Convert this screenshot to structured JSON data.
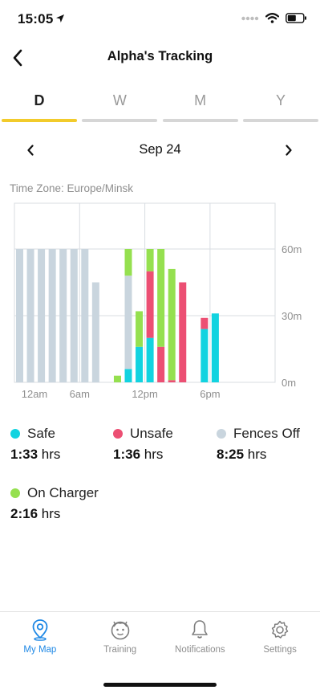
{
  "status_bar": {
    "time": "15:05"
  },
  "header": {
    "title": "Alpha's Tracking",
    "back_icon": "chevron-left-icon"
  },
  "tabs": [
    {
      "label": "D",
      "active": true
    },
    {
      "label": "W",
      "active": false
    },
    {
      "label": "M",
      "active": false
    },
    {
      "label": "Y",
      "active": false
    }
  ],
  "date_nav": {
    "date": "Sep 24",
    "prev_icon": "chevron-left-icon",
    "next_icon": "chevron-right-icon"
  },
  "timezone": "Time Zone: Europe/Minsk",
  "colors": {
    "safe": "#12d3e0",
    "unsafe": "#ec4f73",
    "fences_off": "#c9d5de",
    "on_charger": "#95e04f",
    "accent": "#f2cb2b",
    "active_nav": "#1e88e5"
  },
  "chart_data": {
    "type": "bar",
    "stacked": true,
    "x_tick_labels": [
      "12am",
      "6am",
      "12pm",
      "6pm"
    ],
    "y_tick_labels": [
      "60m",
      "30m",
      "0m"
    ],
    "ylim": [
      0,
      60
    ],
    "grid": true,
    "hours": [
      0,
      1,
      2,
      3,
      4,
      5,
      6,
      7,
      8,
      9,
      10,
      11,
      12,
      13,
      14,
      15,
      16,
      17,
      18,
      19,
      20,
      21,
      22,
      23
    ],
    "series": [
      {
        "name": "Safe",
        "color": "#12d3e0",
        "values": [
          0,
          0,
          0,
          0,
          0,
          0,
          0,
          0,
          0,
          0,
          6,
          16,
          20,
          0,
          0,
          0,
          0,
          24,
          31,
          0,
          0,
          0,
          0,
          0
        ]
      },
      {
        "name": "Unsafe",
        "color": "#ec4f73",
        "values": [
          0,
          0,
          0,
          0,
          0,
          0,
          0,
          0,
          0,
          0,
          0,
          0,
          30,
          16,
          1,
          45,
          0,
          5,
          0,
          0,
          0,
          0,
          0,
          0
        ]
      },
      {
        "name": "Fences Off",
        "color": "#c9d5de",
        "values": [
          60,
          60,
          60,
          60,
          60,
          60,
          60,
          45,
          0,
          0,
          42,
          0,
          0,
          0,
          0,
          0,
          0,
          0,
          0,
          0,
          0,
          0,
          0,
          0
        ]
      },
      {
        "name": "On Charger",
        "color": "#95e04f",
        "values": [
          0,
          0,
          0,
          0,
          0,
          0,
          0,
          0,
          0,
          3,
          12,
          16,
          10,
          44,
          50,
          0,
          0,
          0,
          0,
          0,
          0,
          0,
          0,
          0
        ]
      }
    ]
  },
  "legend": [
    {
      "name": "Safe",
      "value": "1:33",
      "unit": "hrs",
      "color": "#12d3e0"
    },
    {
      "name": "Unsafe",
      "value": "1:36",
      "unit": "hrs",
      "color": "#ec4f73"
    },
    {
      "name": "Fences Off",
      "value": "8:25",
      "unit": "hrs",
      "color": "#c9d5de"
    },
    {
      "name": "On Charger",
      "value": "2:16",
      "unit": "hrs",
      "color": "#95e04f"
    }
  ],
  "bottom_nav": [
    {
      "label": "My Map",
      "icon": "map-pin-icon",
      "active": true
    },
    {
      "label": "Training",
      "icon": "face-icon",
      "active": false
    },
    {
      "label": "Notifications",
      "icon": "bell-icon",
      "active": false
    },
    {
      "label": "Settings",
      "icon": "gear-icon",
      "active": false
    }
  ]
}
